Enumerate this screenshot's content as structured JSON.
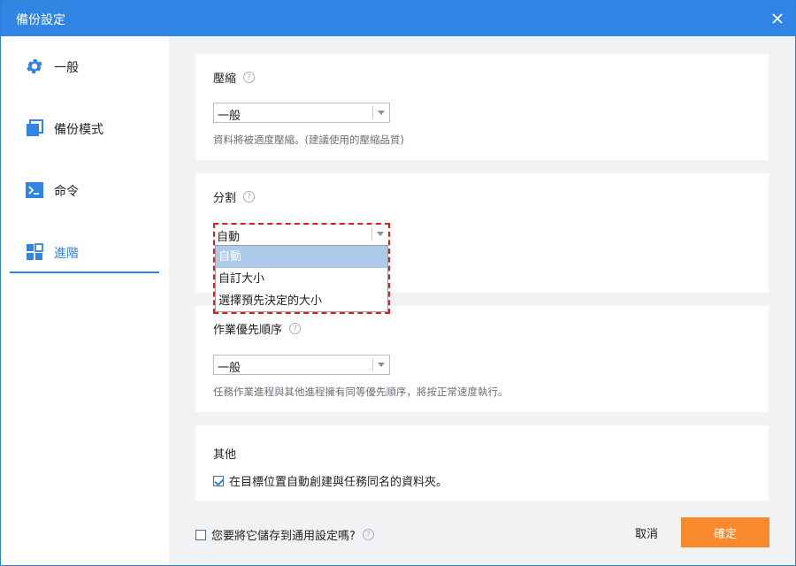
{
  "window": {
    "title": "備份設定"
  },
  "sidebar": {
    "items": [
      {
        "label": "一般",
        "icon": "gear-icon"
      },
      {
        "label": "備份模式",
        "icon": "copy-icon"
      },
      {
        "label": "命令",
        "icon": "terminal-icon"
      },
      {
        "label": "進階",
        "icon": "grid-icon",
        "active": true
      }
    ]
  },
  "compression": {
    "title": "壓縮",
    "selected": "一般",
    "description": "資料將被適度壓縮。(建議使用的壓縮品質)"
  },
  "split": {
    "title": "分割",
    "selected": "自動",
    "options": [
      "自動",
      "自訂大小",
      "選擇預先決定的大小"
    ],
    "highlighted": "自動"
  },
  "priority": {
    "title": "作業優先順序",
    "selected": "一般",
    "description": "任務作業進程與其他進程擁有同等優先順序，將按正常速度執行。"
  },
  "other": {
    "title": "其他",
    "checkbox_label": "在目標位置自動創建與任務同名的資料夾。",
    "checked": true
  },
  "footer": {
    "save_default_label": "您要將它儲存到通用設定嗎?",
    "save_default_checked": false,
    "cancel_label": "取消",
    "ok_label": "確定"
  },
  "colors": {
    "accent": "#2f84e4",
    "ok_button": "#f98a2c",
    "dropdown_highlight": "#aecaeb",
    "annotation_border": "#e01b1b"
  }
}
